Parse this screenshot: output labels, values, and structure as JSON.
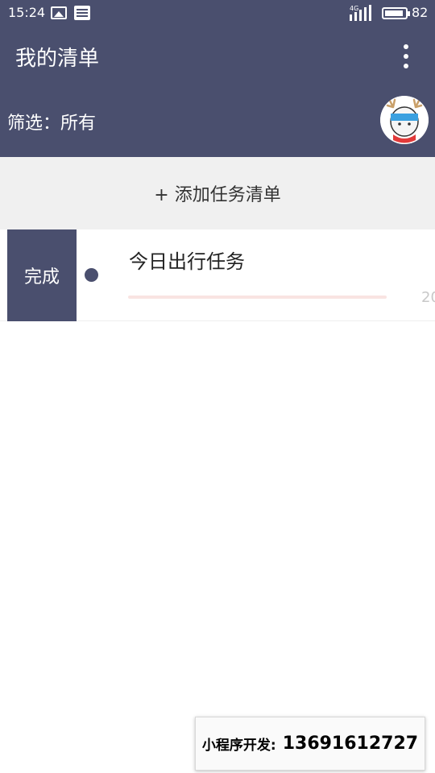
{
  "status_bar": {
    "time": "15:24",
    "network": "4G",
    "battery": "82",
    "icons": [
      "image-icon",
      "document-icon",
      "signal-icon",
      "battery-icon"
    ]
  },
  "header": {
    "title": "我的清单",
    "filter": "筛选：所有",
    "menu_icon": "more-vertical-icon",
    "avatar_icon": "reindeer-avatar"
  },
  "add_list": {
    "label": "+ 添加任务清单"
  },
  "lists": [
    {
      "action_label": "完成",
      "title": "今日出行任务",
      "progress": 0,
      "date_partial": "20"
    }
  ],
  "watermark": {
    "label": "小程序开发:",
    "phone": "13691612727"
  },
  "colors": {
    "primary": "#4a4f6e",
    "add_bar_bg": "#f0f0f0",
    "progress_track": "#f9e4e2",
    "date_text": "#c8c8c8"
  }
}
